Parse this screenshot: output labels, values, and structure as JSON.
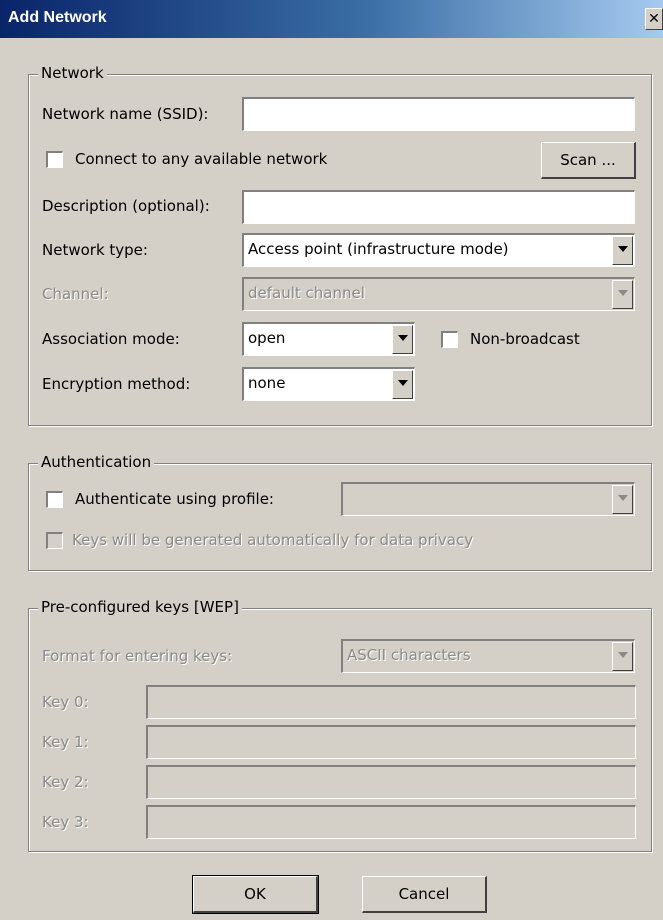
{
  "window": {
    "title": "Add Network",
    "close_glyph": "✕"
  },
  "network": {
    "legend": "Network",
    "ssid_label": "Network name (SSID):",
    "ssid_value": "",
    "connect_any_label": "Connect to any available network",
    "connect_any_checked": false,
    "scan_label": "Scan ...",
    "description_label": "Description (optional):",
    "description_value": "",
    "type_label": "Network type:",
    "type_value": "Access point (infrastructure mode)",
    "channel_label": "Channel:",
    "channel_value": "default channel",
    "association_label": "Association mode:",
    "association_value": "open",
    "non_broadcast_label": "Non-broadcast",
    "non_broadcast_checked": false,
    "encryption_label": "Encryption method:",
    "encryption_value": "none"
  },
  "authentication": {
    "legend": "Authentication",
    "auth_profile_label": "Authenticate using profile:",
    "auth_profile_checked": false,
    "auth_profile_value": "",
    "keys_auto_label": "Keys will be generated automatically for data privacy",
    "keys_auto_checked": false
  },
  "wep": {
    "legend": "Pre-configured keys [WEP]",
    "format_label": "Format for entering keys:",
    "format_value": "ASCII characters",
    "keys": [
      {
        "label": "Key 0:",
        "value": ""
      },
      {
        "label": "Key 1:",
        "value": ""
      },
      {
        "label": "Key 2:",
        "value": ""
      },
      {
        "label": "Key 3:",
        "value": ""
      }
    ]
  },
  "buttons": {
    "ok": "OK",
    "cancel": "Cancel"
  },
  "colors": {
    "face": "#d4d0c8",
    "title_start": "#0a246a",
    "title_end": "#a6caf0",
    "disabled_text": "#8a8a8a"
  }
}
